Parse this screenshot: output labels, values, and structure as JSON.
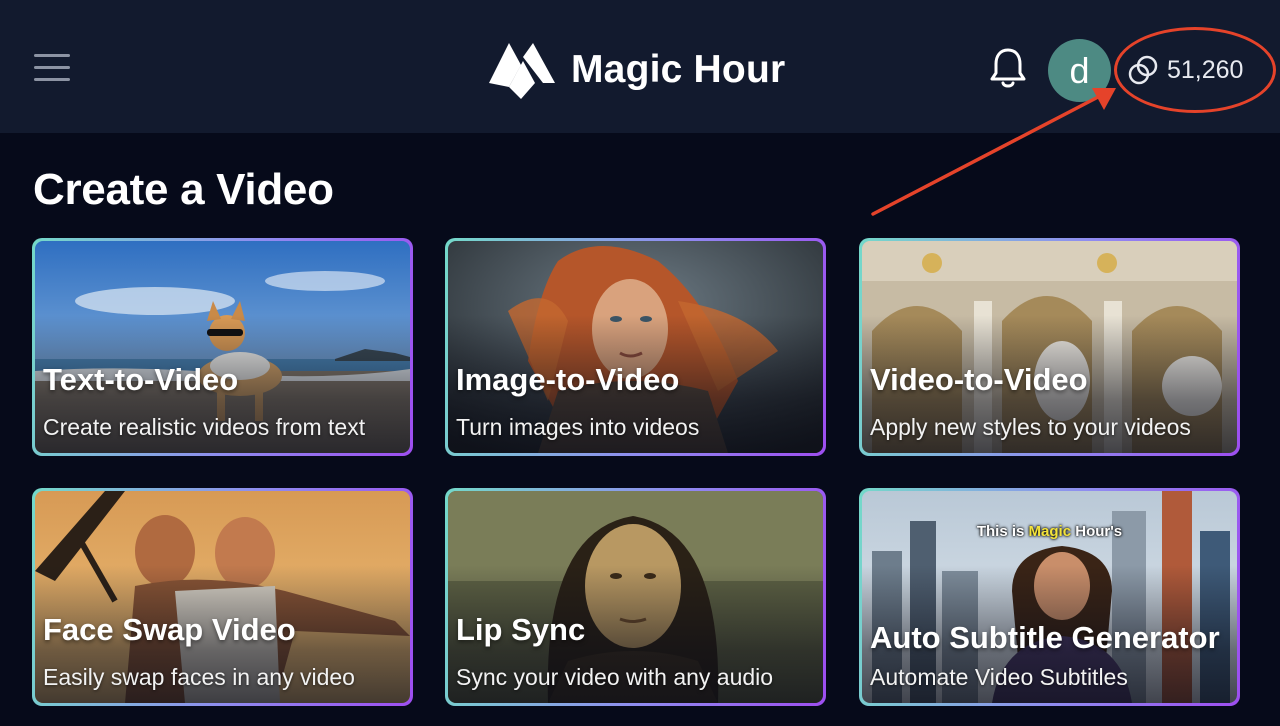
{
  "header": {
    "brand_name": "Magic Hour",
    "avatar_letter": "d",
    "credits": "51,260",
    "icons": [
      "menu-icon",
      "magic-hour-logo",
      "bell-icon",
      "coins-icon"
    ]
  },
  "main": {
    "section_title": "Create a Video",
    "cards": [
      {
        "title": "Text-to-Video",
        "description": "Create realistic videos from text"
      },
      {
        "title": "Image-to-Video",
        "description": "Turn images into videos"
      },
      {
        "title": "Video-to-Video",
        "description": "Apply new styles to your videos"
      },
      {
        "title": "Face Swap Video",
        "description": "Easily swap faces in any video"
      },
      {
        "title": "Lip Sync",
        "description": "Sync your video with any audio"
      },
      {
        "title": "Auto Subtitle Generator",
        "description": "Automate Video Subtitles",
        "overlay_prefix": "This is ",
        "overlay_highlight": "Magic",
        "overlay_suffix": " Hour's"
      }
    ]
  },
  "colors": {
    "background": "#060a1a",
    "header_bg": "#121a2e",
    "avatar_bg": "#4d8a83",
    "annotation_red": "#e5432a",
    "card_border_start": "#74d9c9",
    "card_border_end": "#9d4ef0"
  }
}
